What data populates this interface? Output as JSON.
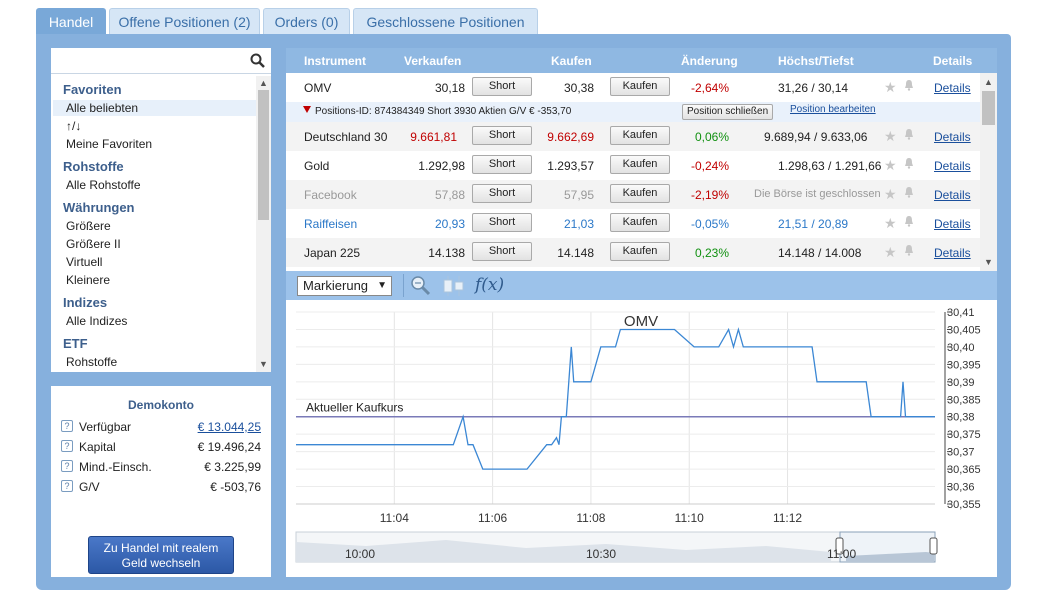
{
  "tabs": [
    {
      "label": "Handel",
      "active": true
    },
    {
      "label": "Offene Positionen (2)"
    },
    {
      "label": "Orders (0)"
    },
    {
      "label": "Geschlossene Positionen"
    }
  ],
  "sidebar": {
    "search_placeholder": "",
    "groups": [
      {
        "title": "Favoriten",
        "items": [
          "Alle beliebten",
          "↑/↓",
          "Meine Favoriten"
        ]
      },
      {
        "title": "Rohstoffe",
        "items": [
          "Alle Rohstoffe"
        ]
      },
      {
        "title": "Währungen",
        "items": [
          "Größere",
          "Größere II",
          "Virtuell",
          "Kleinere"
        ]
      },
      {
        "title": "Indizes",
        "items": [
          "Alle Indizes"
        ]
      },
      {
        "title": "ETF",
        "items": [
          "Rohstoffe"
        ]
      }
    ]
  },
  "account": {
    "title": "Demokonto",
    "rows": [
      {
        "label": "Verfügbar",
        "value": "€ 13.044,25"
      },
      {
        "label": "Kapital",
        "value": "€ 19.496,24"
      },
      {
        "label": "Mind.-Einsch.",
        "value": "€ 3.225,99"
      },
      {
        "label": "G/V",
        "value": "€ -503,76"
      }
    ],
    "real_button": [
      "Zu Handel mit realem",
      "Geld wechseln"
    ]
  },
  "table": {
    "headers": [
      "Instrument",
      "Verkaufen",
      "Kaufen",
      "Änderung",
      "Höchst/Tiefst",
      "Details"
    ],
    "short_label": "Short",
    "buy_label": "Kaufen",
    "details_label": "Details",
    "rows": [
      {
        "name": "OMV",
        "sell": "30,18",
        "buy": "30,38",
        "change": "-2,64%",
        "hl": "31,26 / 30,14",
        "style": "normal",
        "change_class": "red"
      },
      {
        "name": "Deutschland 30",
        "sell": "9.661,81",
        "buy": "9.662,69",
        "change": "0,06%",
        "hl": "9.689,94 / 9.633,06",
        "style": "red",
        "change_class": "green"
      },
      {
        "name": "Gold",
        "sell": "1.292,98",
        "buy": "1.293,57",
        "change": "-0,24%",
        "hl": "1.298,63 / 1.291,66",
        "style": "normal",
        "change_class": "red"
      },
      {
        "name": "Facebook",
        "sell": "57,88",
        "buy": "57,95",
        "change": "-2,19%",
        "hl": "Die Börse ist geschlossen",
        "style": "grey",
        "change_class": "red"
      },
      {
        "name": "Raiffeisen",
        "sell": "20,93",
        "buy": "21,03",
        "change": "-0,05%",
        "hl": "21,51 / 20,89",
        "style": "blue",
        "change_class": "blue"
      },
      {
        "name": "Japan 225",
        "sell": "14.138",
        "buy": "14.148",
        "change": "0,23%",
        "hl": "14.148 / 14.008",
        "style": "normal",
        "change_class": "green"
      }
    ],
    "position": {
      "text": "Positions-ID: 874384349 Short 3930 Aktien G/V € -353,70",
      "close": "Position schließen",
      "edit": "Position bearbeiten"
    }
  },
  "toolbar": {
    "select_value": "Markierung",
    "fx_label": "f(x)"
  },
  "colors": {
    "accent": "#86b0dd",
    "line": "#3b87d4",
    "negative": "#c00000",
    "positive": "#109010"
  },
  "chart_data": {
    "type": "line",
    "title": "OMV",
    "annotation": "Aktueller Kaufkurs",
    "kaufkurs": 30.38,
    "ylim": [
      30.355,
      30.41
    ],
    "yticks": [
      "30,41",
      "30,405",
      "30,40",
      "30,395",
      "30,39",
      "30,385",
      "30,38",
      "30,375",
      "30,37",
      "30,365",
      "30,36",
      "30,355"
    ],
    "xticks": [
      "11:04",
      "11:06",
      "11:08",
      "11:10",
      "11:12"
    ],
    "x_minutes": [
      0,
      3.2,
      3.4,
      3.5,
      3.6,
      3.8,
      4.7,
      5.1,
      5.2,
      5.3,
      5.35,
      5.4,
      5.5,
      5.6,
      5.65,
      5.7,
      5.9,
      6.0,
      6.2,
      6.5,
      6.6,
      7.0,
      7.7,
      8.1,
      8.3,
      8.6,
      8.8,
      8.9,
      9.0,
      9.1,
      9.2,
      9.7,
      10.5,
      10.6,
      11.2,
      11.6,
      11.7,
      11.75,
      12.1,
      12.3,
      12.35,
      12.4,
      13.0
    ],
    "y_values": [
      30.372,
      30.372,
      30.38,
      30.372,
      30.372,
      30.365,
      30.365,
      30.372,
      30.372,
      30.374,
      30.372,
      30.38,
      30.38,
      30.4,
      30.39,
      30.39,
      30.39,
      30.39,
      30.4,
      30.4,
      30.405,
      30.405,
      30.405,
      30.4,
      30.4,
      30.4,
      30.405,
      30.4,
      30.405,
      30.4,
      30.4,
      30.4,
      30.4,
      30.39,
      30.39,
      30.39,
      30.38,
      30.38,
      30.38,
      30.38,
      30.39,
      30.38,
      30.38
    ],
    "navigator_ticks": [
      "10:00",
      "10:30",
      "11:00"
    ]
  }
}
